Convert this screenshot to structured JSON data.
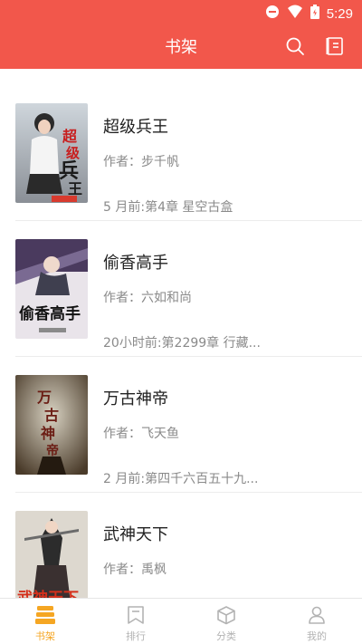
{
  "status": {
    "time": "5:29"
  },
  "appbar": {
    "title": "书架"
  },
  "books": [
    {
      "title": "超级兵王",
      "author": "作者：步千帆",
      "latest": "5 月前:第4章 星空古盒"
    },
    {
      "title": "偷香高手",
      "author": "作者：六如和尚",
      "latest": "20小时前:第2299章 行藏..."
    },
    {
      "title": "万古神帝",
      "author": "作者：飞天鱼",
      "latest": "2 月前:第四千六百五十九..."
    },
    {
      "title": "武神天下",
      "author": "作者：禹枫",
      "latest": ""
    }
  ],
  "tabs": [
    {
      "label": "书架",
      "icon": "bookshelf-icon",
      "active": true
    },
    {
      "label": "排行",
      "icon": "bookmark-icon",
      "active": false
    },
    {
      "label": "分类",
      "icon": "box-icon",
      "active": false
    },
    {
      "label": "我的",
      "icon": "person-icon",
      "active": false
    }
  ],
  "colors": {
    "primary": "#f2574b",
    "tab_active": "#f5a623",
    "tab_inactive": "#b3b3b3"
  }
}
